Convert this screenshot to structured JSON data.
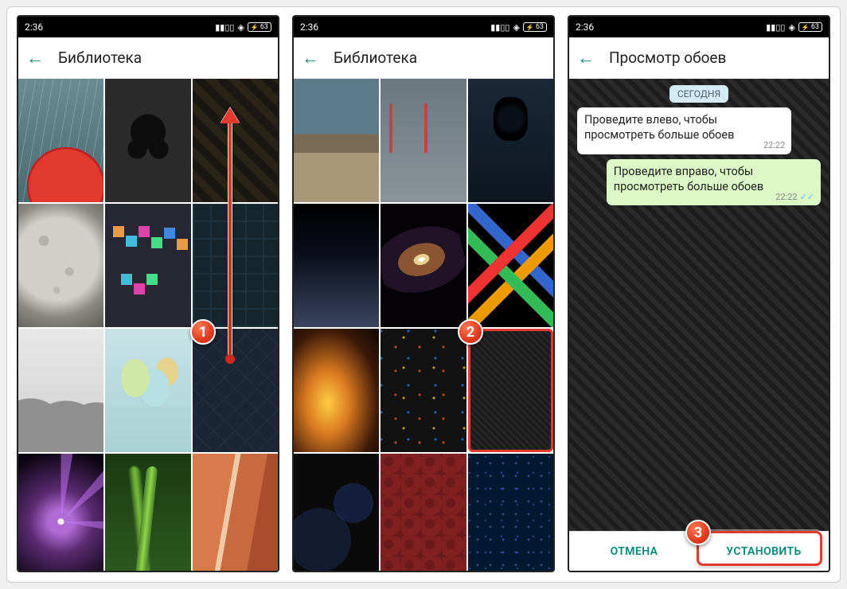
{
  "status": {
    "time": "2:36",
    "battery": "63"
  },
  "screen1": {
    "title": "Библиотека",
    "badge": "1"
  },
  "screen2": {
    "title": "Библиотека",
    "badge": "2"
  },
  "screen3": {
    "title": "Просмотр обоев",
    "badge": "3",
    "date_chip": "СЕГОДНЯ",
    "msg_in": "Проведите влево, чтобы просмотреть больше обоев",
    "msg_in_time": "22:22",
    "msg_out": "Проведите вправо, чтобы просмотреть больше обоев",
    "msg_out_time": "22:22",
    "btn_cancel": "ОТМЕНА",
    "btn_set": "УСТАНОВИТЬ"
  }
}
